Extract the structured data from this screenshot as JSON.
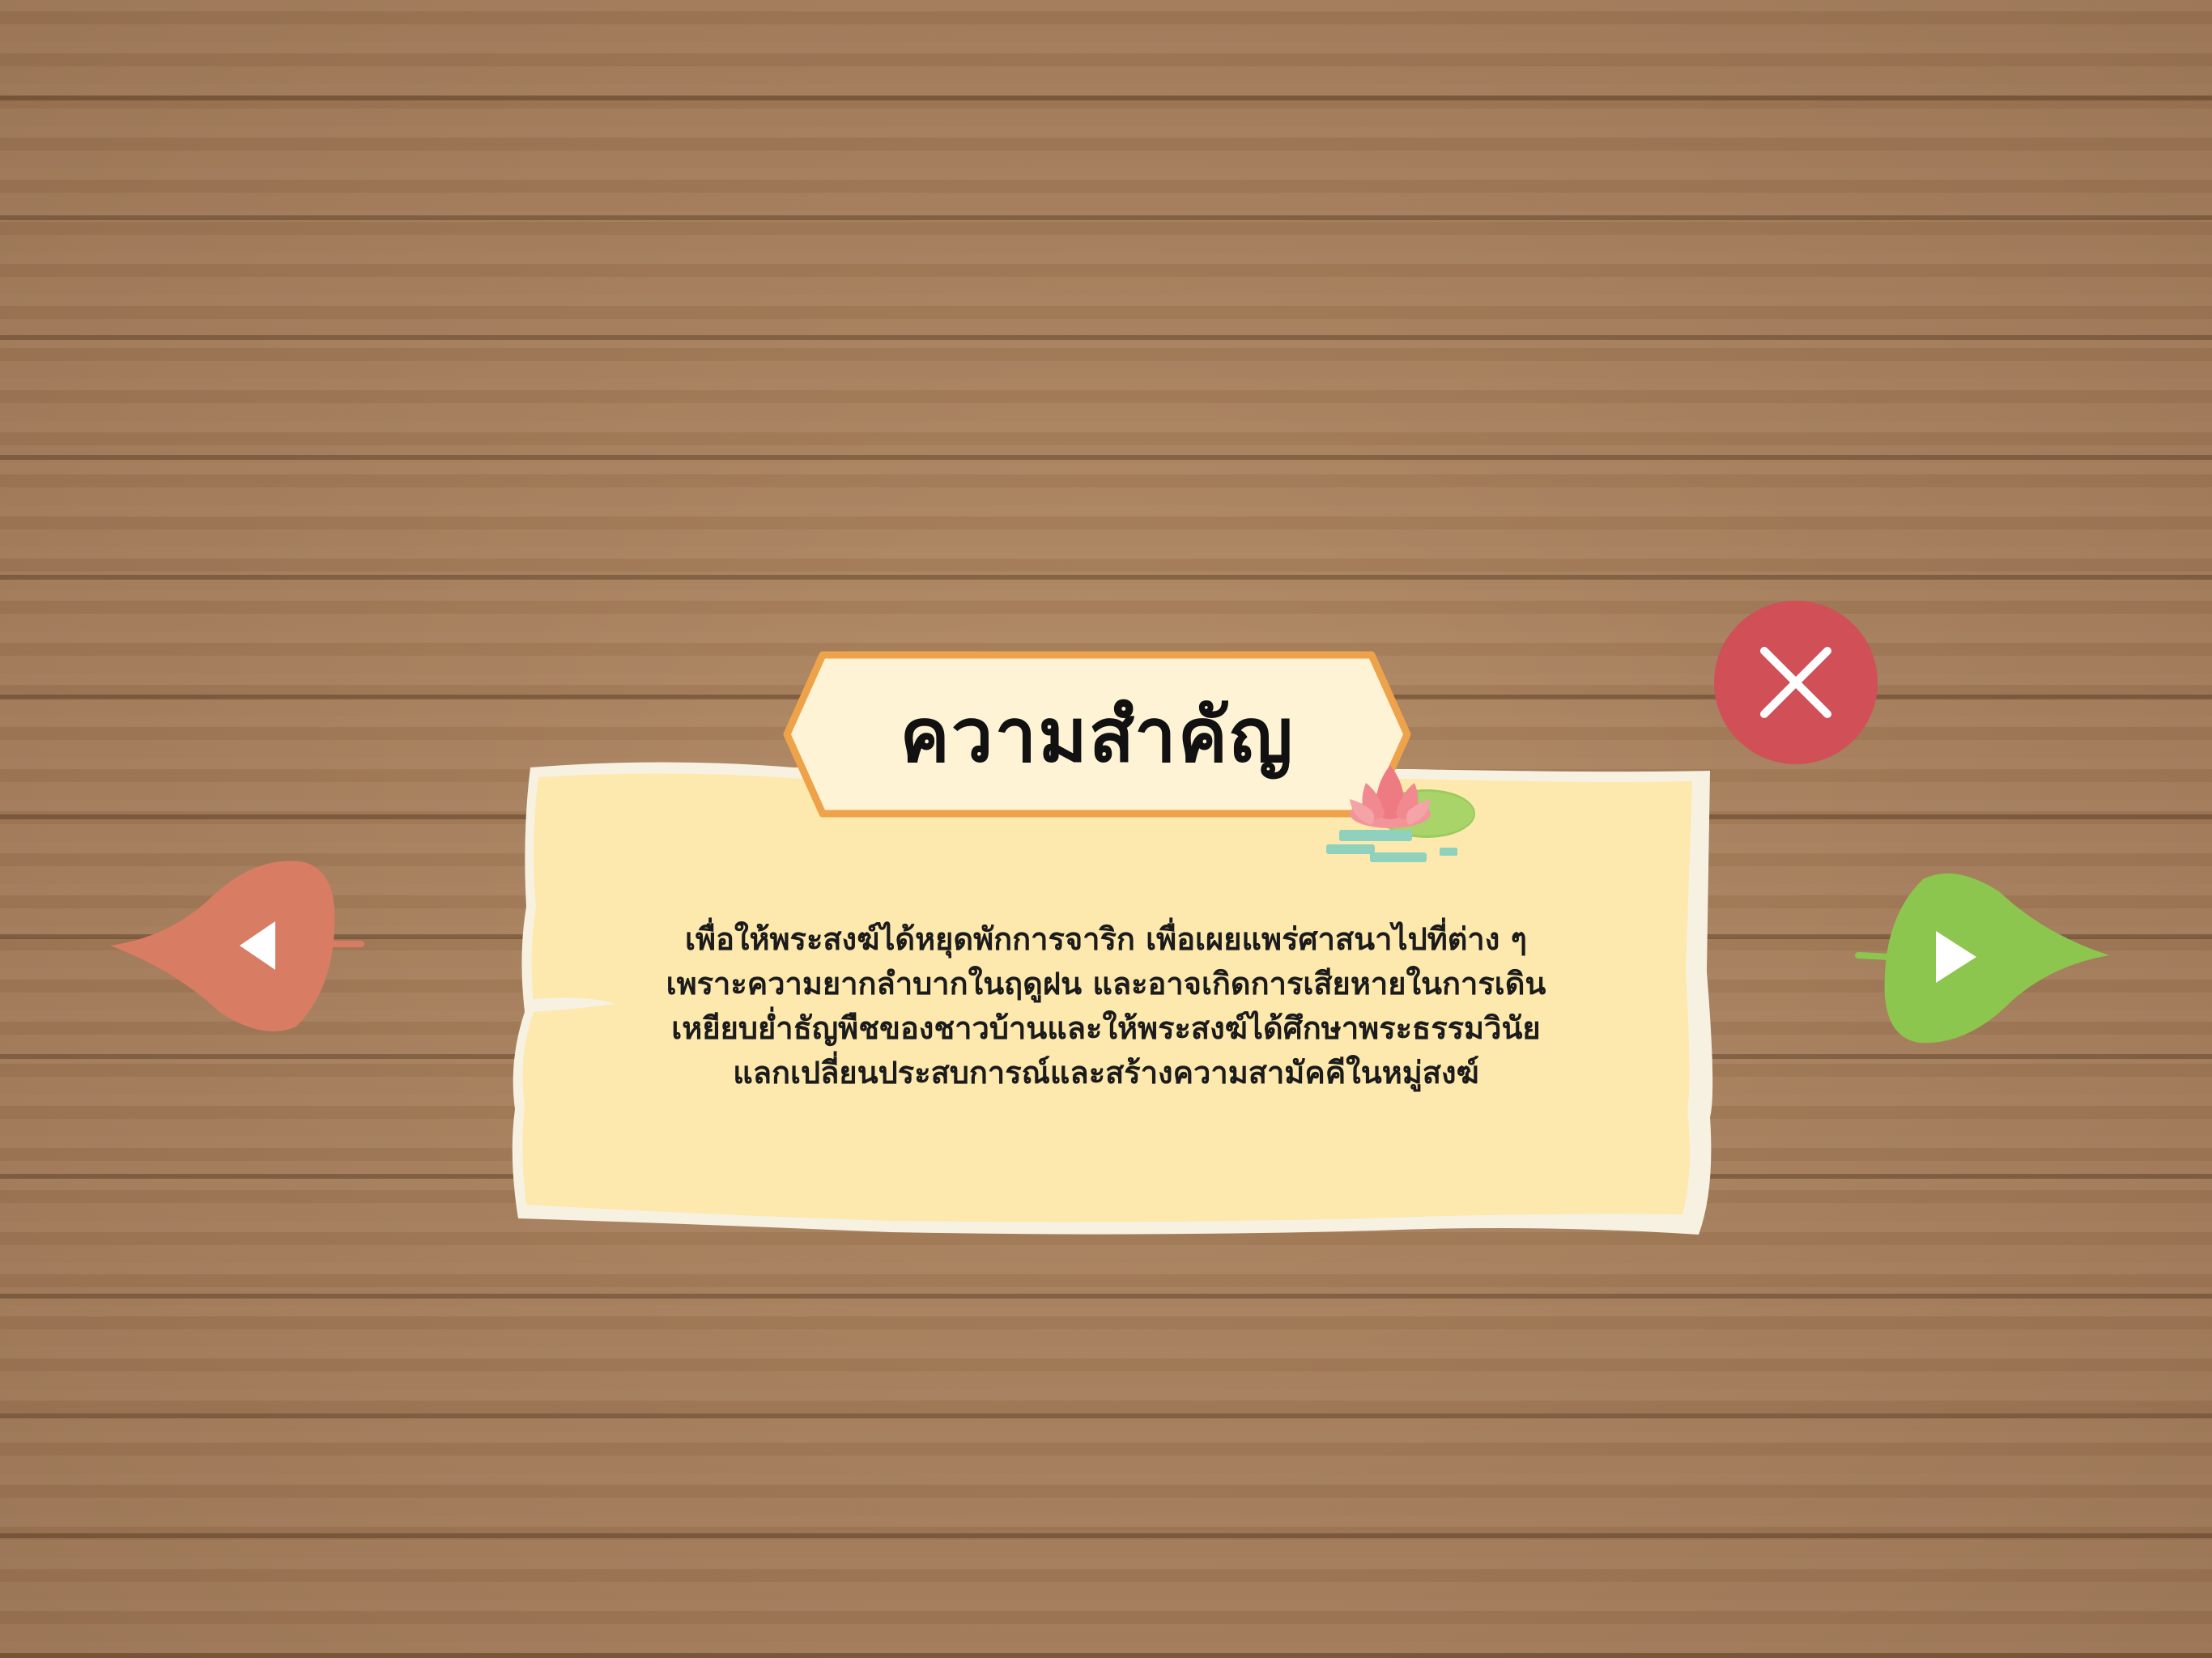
{
  "dialog": {
    "title": "ความสำคัญ",
    "body_lines": [
      "เพื่อให้พระสงฆ์ได้หยุดพักการจาริก เพื่อเผยแพร่ศาสนาไปที่ต่าง ๆ",
      "เพราะความยากลำบากในฤดูฝน และอาจเกิดการเสียหายในการเดิน",
      "เหยียบย่ำธัญพืชของชาวบ้านและให้พระสงฆ์ได้ศึกษาพระธรรมวินัย",
      "แลกเปลี่ยนประสบการณ์และสร้างความสามัคคีในหมู่สงฆ์"
    ]
  },
  "controls": {
    "close_icon": "close-x-icon",
    "prev_icon": "leaf-left-arrow-icon",
    "next_icon": "leaf-right-arrow-icon"
  },
  "decor": {
    "lotus_icon": "lotus-flower-icon"
  },
  "colors": {
    "wood_background": "#a47b58",
    "paper": "#fde9ad",
    "paper_edge": "#f7f1e1",
    "plaque_fill": "#fff3d6",
    "plaque_border": "#eea24a",
    "close_button": "#d14f57",
    "prev_leaf": "#d87c63",
    "next_leaf": "#8dc64e",
    "lotus_pink": "#ee7a82"
  }
}
